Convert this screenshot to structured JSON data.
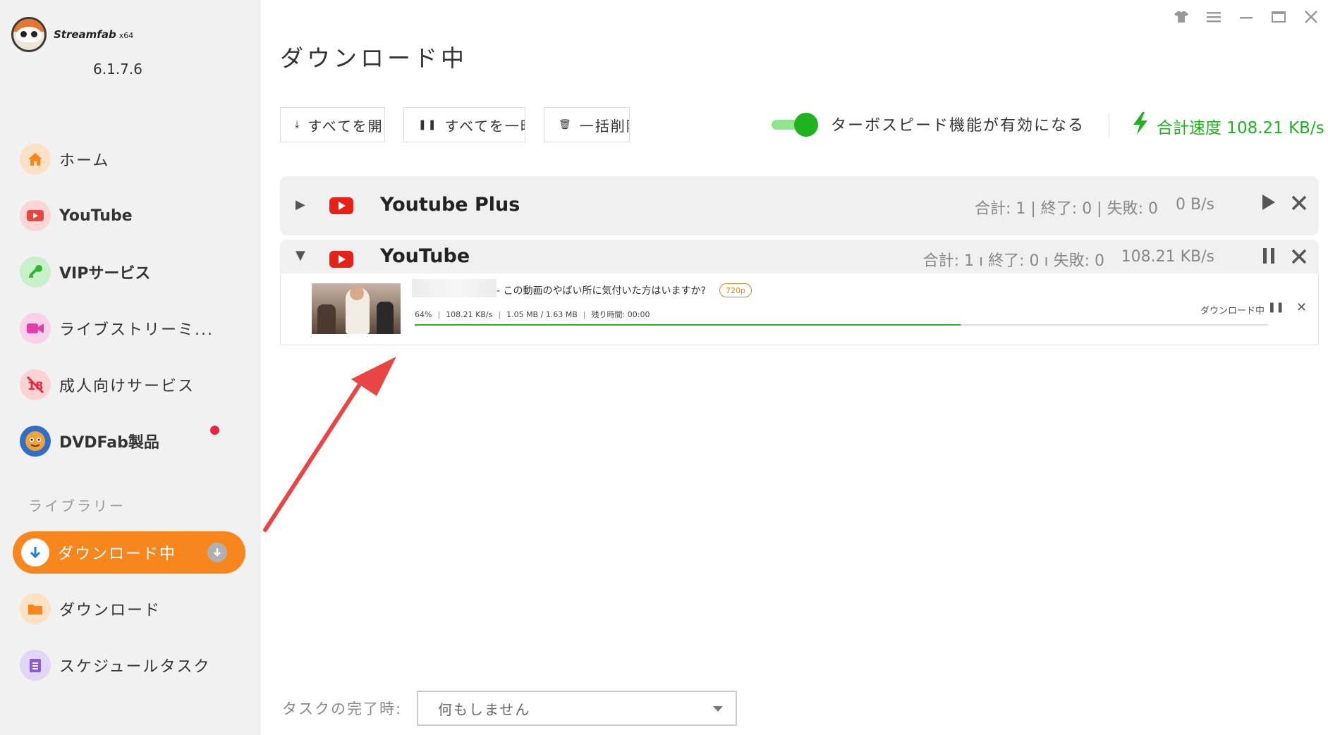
{
  "app": {
    "brand": "Streamfab",
    "arch": "x64",
    "version": "6.1.7.6"
  },
  "sidebar": {
    "items": [
      {
        "label": "ホーム",
        "icon": "home-icon"
      },
      {
        "label": "YouTube",
        "icon": "youtube-icon"
      },
      {
        "label": "VIPサービス",
        "icon": "key-icon"
      },
      {
        "label": "ライブストリーミ...",
        "icon": "camera-icon"
      },
      {
        "label": "成人向けサービス",
        "icon": "adult-icon"
      },
      {
        "label": "DVDFab製品",
        "icon": "dvdfab-icon"
      }
    ],
    "library_title": "ライブラリー",
    "library": [
      {
        "label": "ダウンロード中",
        "icon": "download-arrow-icon",
        "active": true
      },
      {
        "label": "ダウンロード",
        "icon": "folder-icon"
      },
      {
        "label": "スケジュールタスク",
        "icon": "schedule-icon"
      }
    ]
  },
  "window_controls": [
    "shirt-icon",
    "menu-icon",
    "minimize-icon",
    "maximize-icon",
    "close-icon"
  ],
  "main": {
    "title": "ダウンロード中",
    "toolbar": {
      "start_all": "すべてを開",
      "pause_all": "すべてを一時",
      "delete_all": "一括削除",
      "turbo_label": "ターボスピード機能が有効になる",
      "turbo_enabled": true,
      "total_speed_label": "合計速度 108.21 KB/s"
    },
    "groups": [
      {
        "name": "Youtube Plus",
        "expanded": false,
        "stats": "合計: 1 | 終了: 0 | 失敗: 0",
        "speed": "0 B/s"
      },
      {
        "name": "YouTube",
        "expanded": true,
        "stats": "合計: 1 ı 終了: 0 ı 失敗: 0",
        "speed": "108.21 KB/s",
        "tasks": [
          {
            "title": "- この動画のやばい所に気付いた方はいますか?",
            "resolution": "720p",
            "percent": "64%",
            "speed": "108.21 KB/s",
            "size": "1.05 MB / 1.63 MB",
            "remaining_label": "残り時間:",
            "remaining": "00:00",
            "status": "ダウンロード中",
            "progress": 0.64
          }
        ]
      }
    ]
  },
  "footer": {
    "complete_label": "タスクの完了時:",
    "complete_value": "何もしません"
  },
  "colors": {
    "accent": "#f7861c",
    "turbo_green": "#1fb31f",
    "speed_green": "#22b022",
    "youtube_red": "#e62117",
    "annotation_arrow": "#e84545"
  }
}
